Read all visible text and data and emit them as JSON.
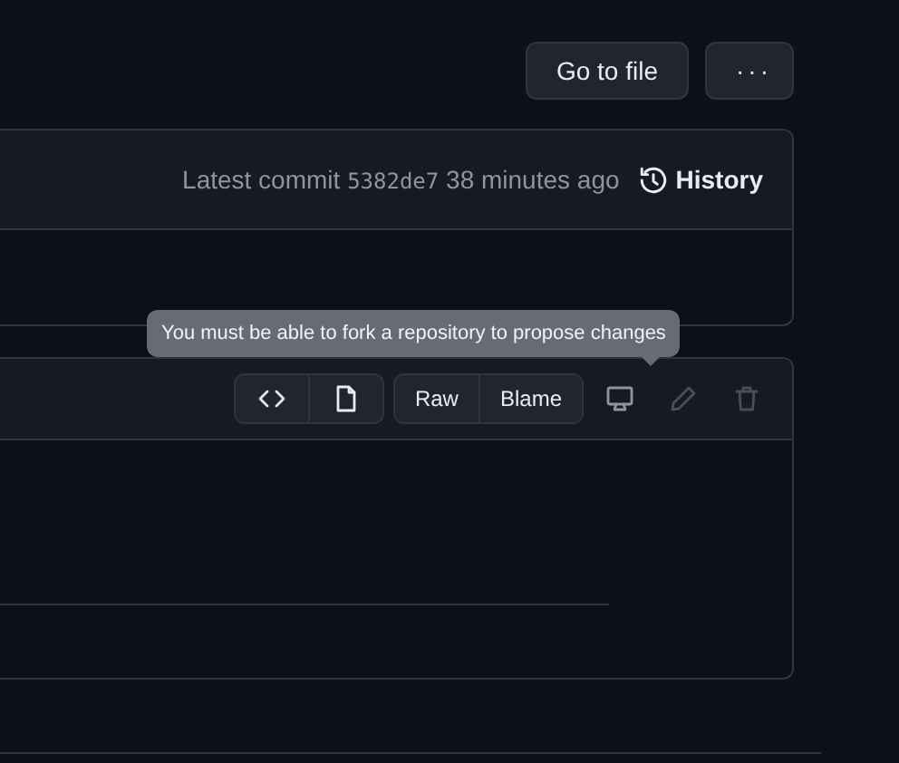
{
  "top_actions": {
    "go_to_file": "Go to file",
    "more": "···"
  },
  "commit_bar": {
    "label": "Latest commit",
    "sha": "5382de7",
    "time": "38 minutes ago",
    "history": "History"
  },
  "file_toolbar": {
    "view_toggle": [
      {
        "kind": "code"
      },
      {
        "kind": "preview"
      }
    ],
    "buttons": [
      "Raw",
      "Blame"
    ],
    "actions": [
      {
        "kind": "display",
        "disabled": false
      },
      {
        "kind": "edit",
        "disabled": true
      },
      {
        "kind": "delete",
        "disabled": true
      }
    ]
  },
  "tooltip": "You must be able to fork a repository to propose changes"
}
